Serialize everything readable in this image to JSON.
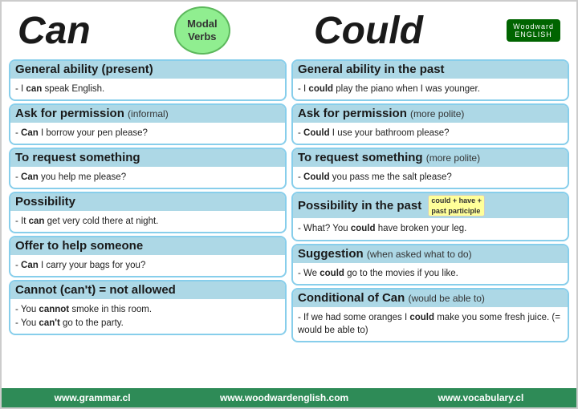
{
  "header": {
    "can_label": "Can",
    "could_label": "Could",
    "modal_verbs_line1": "Modal",
    "modal_verbs_line2": "Verbs",
    "logo_main": "Woodward",
    "logo_sub": "ENGLISH"
  },
  "left_column": {
    "sections": [
      {
        "id": "general-ability-present",
        "title": "General ability (present)",
        "small": "",
        "body": "- I <b>can</b> speak English."
      },
      {
        "id": "ask-permission-informal",
        "title": "Ask for permission",
        "small": "(informal)",
        "body": "- <b>Can</b> I borrow your pen please?"
      },
      {
        "id": "to-request-something",
        "title": "To request something",
        "small": "",
        "body": "- <b>Can</b> you help me please?"
      },
      {
        "id": "possibility",
        "title": "Possibility",
        "small": "",
        "body": "- It <b>can</b> get very cold there at night."
      },
      {
        "id": "offer-to-help",
        "title": "Offer to help someone",
        "small": "",
        "body": "- <b>Can</b> I carry your bags for you?"
      },
      {
        "id": "cannot",
        "title": "Cannot (can't) = not allowed",
        "small": "",
        "body": "- You <b>cannot</b> smoke in this room.\n- You <b>can't</b> go to the party."
      }
    ]
  },
  "right_column": {
    "sections": [
      {
        "id": "general-ability-past",
        "title": "General ability in the past",
        "small": "",
        "body": "- I <b>could</b> play the piano when I was younger."
      },
      {
        "id": "ask-permission-polite",
        "title": "Ask for permission",
        "small": "(more polite)",
        "body": "- <b>Could</b> I use your bathroom please?"
      },
      {
        "id": "to-request-something-polite",
        "title": "To request something",
        "small": "(more polite)",
        "body": "- <b>Could</b> you pass me the salt please?"
      },
      {
        "id": "possibility-past",
        "title": "Possibility in the past",
        "badge": "could + have + past participle",
        "body": "- What? You <b>could</b> have broken your leg."
      },
      {
        "id": "suggestion",
        "title": "Suggestion",
        "small": "(when asked what to do)",
        "body": "- We <b>could</b> go to the movies if you like."
      },
      {
        "id": "conditional-of-can",
        "title": "Conditional of Can",
        "small": "(would be able to)",
        "body": "- If we had some oranges I <b>could</b> make you some fresh juice. (= would be able to)"
      }
    ]
  },
  "footer": {
    "links": [
      "www.grammar.cl",
      "www.woodwardenglish.com",
      "www.vocabulary.cl"
    ]
  }
}
